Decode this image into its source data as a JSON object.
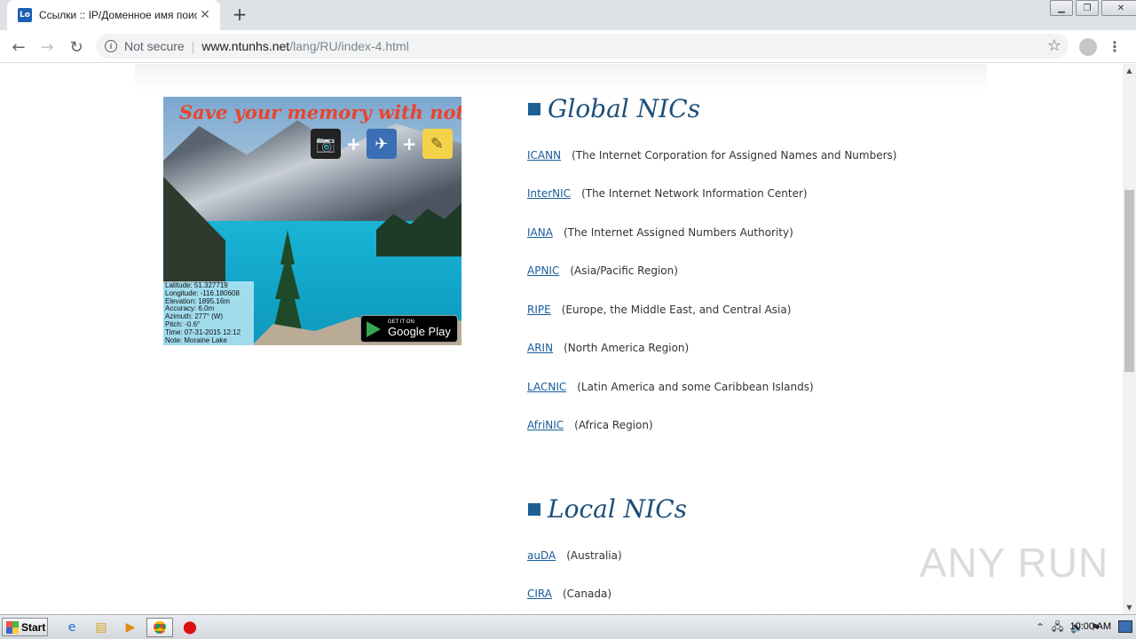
{
  "browser": {
    "tab_title": "Ссылки :: IP/Доменное имя поиска",
    "tab_favicon_text": "Lo",
    "new_tab_symbol": "+",
    "security_label": "Not secure",
    "url_host": "www.ntunhs.net",
    "url_path": "/lang/RU/index-4.html"
  },
  "ad": {
    "headline": "Save your memory with notes",
    "meta_lines": [
      "Latitude: 51.327719",
      "Longitude: -116.180608",
      "Elevation: 1895.16m",
      "Accuracy: 6.0m",
      "Azimuth: 277° (W)",
      "Pitch: -0.6°",
      "Time: 07-31-2015 12:12",
      "Note: Moraine Lake"
    ],
    "store_small": "GET IT ON",
    "store_big": "Google Play"
  },
  "global_nics": {
    "title": "Global NICs",
    "items": [
      {
        "name": "ICANN",
        "desc": "(The Internet Corporation for Assigned Names and Numbers)"
      },
      {
        "name": "InterNIC",
        "desc": "(The Internet Network Information Center)"
      },
      {
        "name": "IANA",
        "desc": "(The Internet Assigned Numbers Authority)"
      },
      {
        "name": "APNIC",
        "desc": "(Asia/Pacific Region)"
      },
      {
        "name": "RIPE",
        "desc": "(Europe, the Middle East, and Central Asia)"
      },
      {
        "name": "ARIN",
        "desc": "(North America Region)"
      },
      {
        "name": "LACNIC",
        "desc": "(Latin America and some Caribbean Islands)"
      },
      {
        "name": "AfriNIC",
        "desc": "(Africa Region)"
      }
    ]
  },
  "local_nics": {
    "title": "Local NICs",
    "items": [
      {
        "name": "auDA",
        "desc": "(Australia)"
      },
      {
        "name": "CIRA",
        "desc": "(Canada)"
      }
    ]
  },
  "watermark": "ANY RUN",
  "taskbar": {
    "start_label": "Start",
    "clock": "10:00 AM"
  },
  "colors": {
    "link": "#1a5b9b",
    "section_title": "#1d4f7a",
    "tab_bar": "#dee1e6"
  }
}
